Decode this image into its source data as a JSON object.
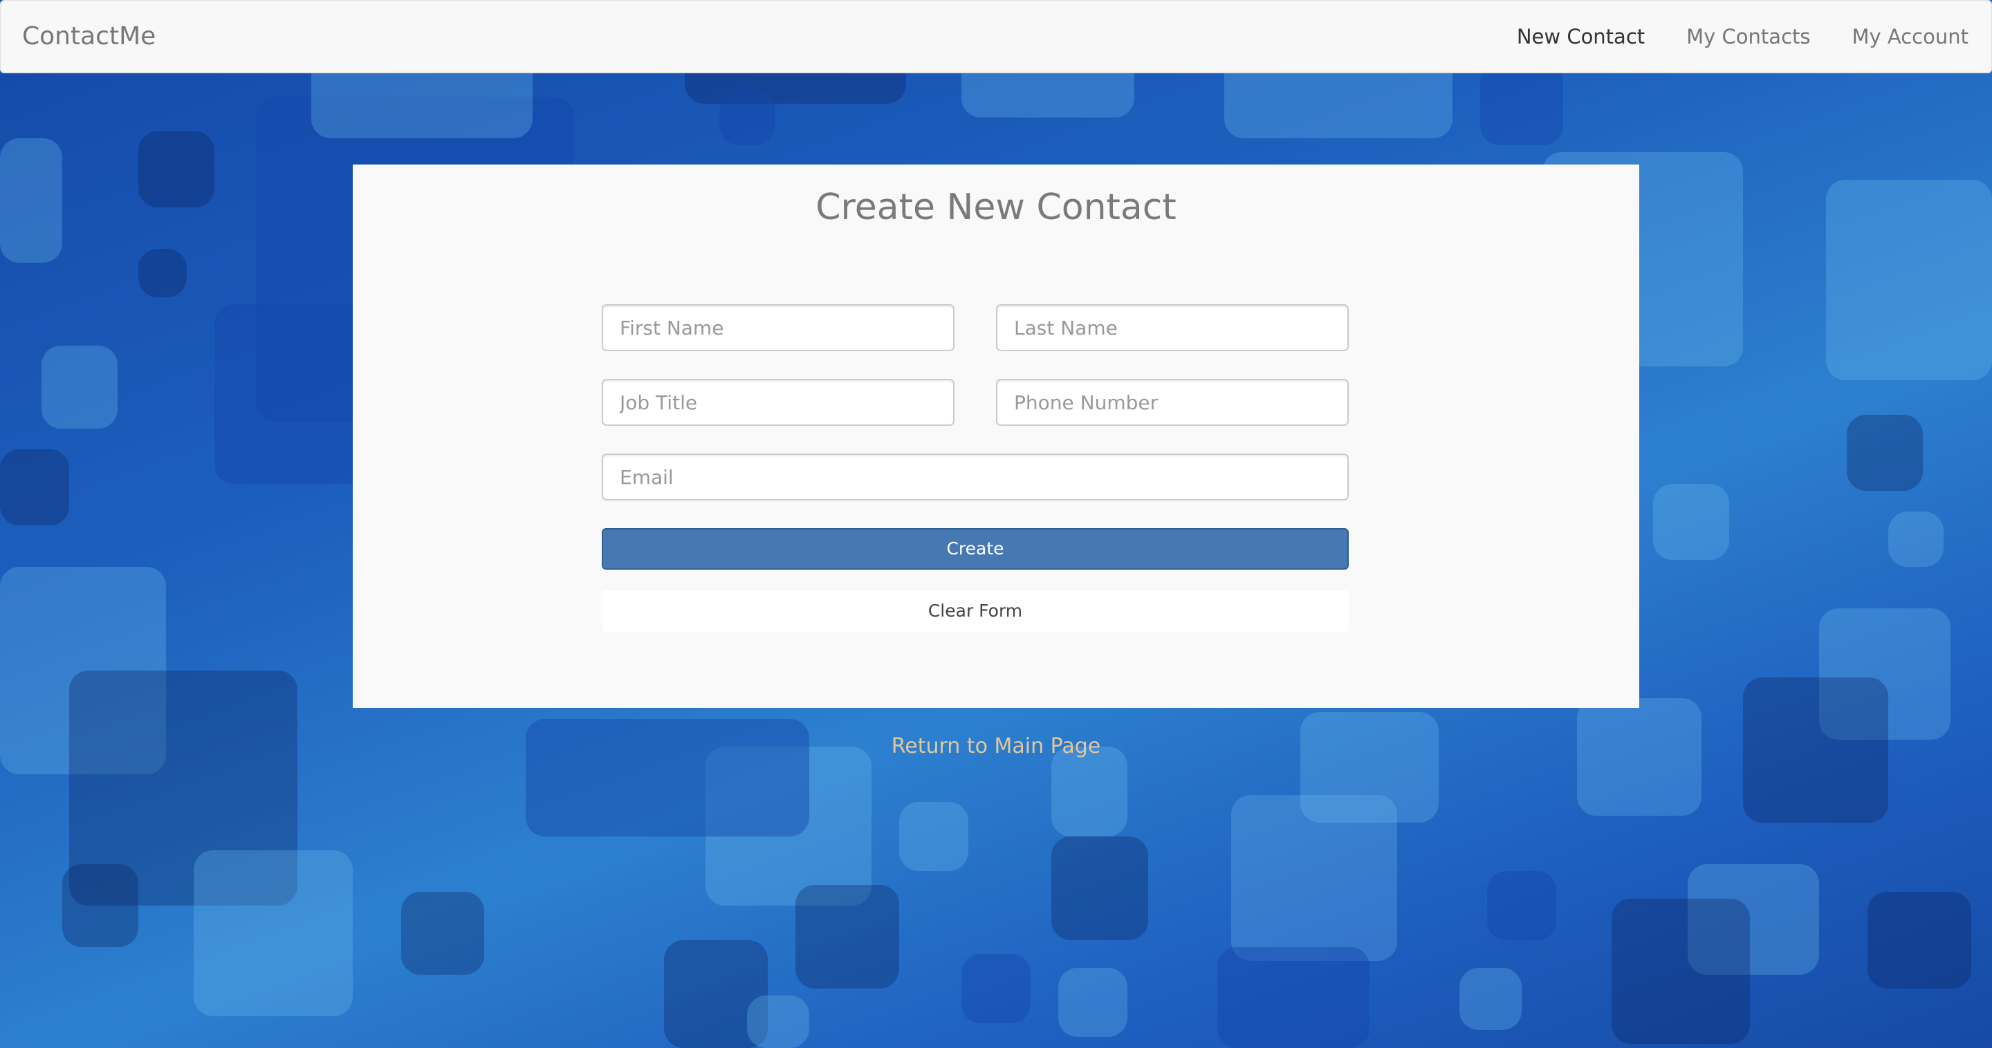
{
  "navbar": {
    "brand": "ContactMe",
    "links": [
      {
        "label": "New Contact",
        "active": true
      },
      {
        "label": "My Contacts",
        "active": false
      },
      {
        "label": "My Account",
        "active": false
      }
    ]
  },
  "form": {
    "title": "Create New Contact",
    "first_name": {
      "value": "",
      "placeholder": "First Name"
    },
    "last_name": {
      "value": "",
      "placeholder": "Last Name"
    },
    "job_title": {
      "value": "",
      "placeholder": "Job Title"
    },
    "phone_number": {
      "value": "",
      "placeholder": "Phone Number"
    },
    "email": {
      "value": "",
      "placeholder": "Email"
    },
    "create_label": "Create",
    "clear_label": "Clear Form"
  },
  "return_link": "Return to Main Page",
  "colors": {
    "background": "#1d5fbd",
    "navbar": "#f8f8f8",
    "primary_button": "#4679b2",
    "return_link": "#e2c79a"
  }
}
